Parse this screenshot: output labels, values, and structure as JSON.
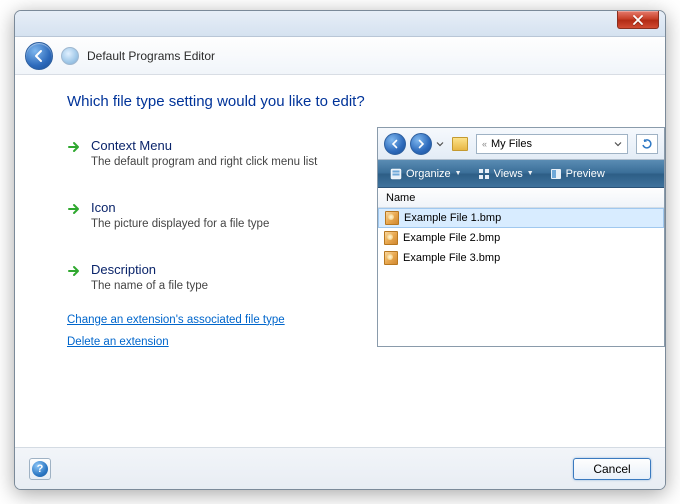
{
  "window": {
    "title": "Default Programs Editor"
  },
  "heading": "Which file type setting would you like to edit?",
  "options": [
    {
      "title": "Context Menu",
      "sub": "The default program and right click menu list"
    },
    {
      "title": "Icon",
      "sub": "The picture displayed for a file type"
    },
    {
      "title": "Description",
      "sub": "The name of a file type"
    }
  ],
  "links": {
    "change": "Change an extension's associated file type",
    "delete": "Delete an extension"
  },
  "preview": {
    "breadcrumb_prefix": "«",
    "breadcrumb_folder": "My Files",
    "toolbar": {
      "organize": "Organize",
      "views": "Views",
      "preview": "Preview"
    },
    "col_name": "Name",
    "files": [
      "Example File 1.bmp",
      "Example File 2.bmp",
      "Example File 3.bmp"
    ]
  },
  "footer": {
    "cancel": "Cancel",
    "help_glyph": "?"
  }
}
